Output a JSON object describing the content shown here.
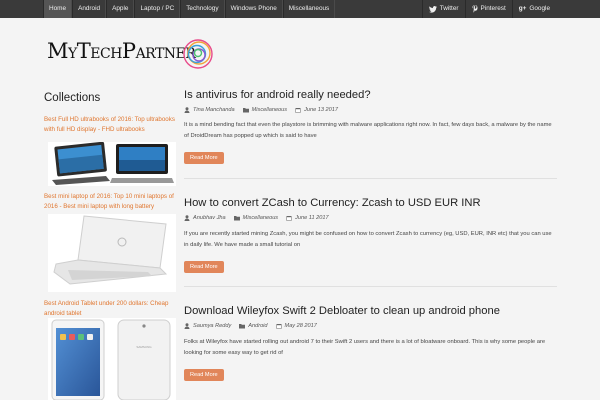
{
  "nav": {
    "items": [
      "Home",
      "Android",
      "Apple",
      "Laptop / PC",
      "Technology",
      "Windows Phone",
      "Miscellaneous"
    ],
    "active": "Home"
  },
  "social": [
    {
      "label": "Twitter",
      "icon": "twitter-icon"
    },
    {
      "label": "Pinterest",
      "icon": "pinterest-icon"
    },
    {
      "label": "Google",
      "icon": "google-plus-icon"
    }
  ],
  "logo": {
    "text": "MyTechPartner"
  },
  "sidebar": {
    "title": "Collections",
    "items": [
      {
        "title": "Best Full HD ultrabooks of 2016: Top ultrabooks with full HD display - FHD ultrabooks",
        "image": "two-ultrabooks"
      },
      {
        "title": "Best mini laptop of 2016: Top 10 mini laptops of 2016 - Best mini laptop with long battery",
        "image": "white-dell-laptop"
      },
      {
        "title": "Best Android Tablet under 200 dollars: Cheap android tablet",
        "image": "samsung-tablets"
      }
    ]
  },
  "posts": [
    {
      "title": "Is antivirus for android really needed?",
      "author": "Tina Manchanda",
      "category": "Miscellaneous",
      "date": "June 13 2017",
      "excerpt": "It is a mind bending fact that even the playstore is brimming with malware applications right now. In fact, few days back, a malware by the name of DroidDream has popped up which is said to have",
      "read_more": "Read More"
    },
    {
      "title": "How to convert ZCash to Currency: Zcash to USD EUR INR",
      "author": "Anubhav Jha",
      "category": "Miscellaneous",
      "date": "June 11 2017",
      "excerpt": "If you are recently started mining Zcash, you might be confused on how to convert Zcash to currency (eg, USD, EUR, INR etc) that you can use in daily life. We have made a small tutorial on",
      "read_more": "Read More"
    },
    {
      "title": "Download Wileyfox Swift 2 Debloater to clean up android phone",
      "author": "Saumya Reddy",
      "category": "Android",
      "date": "May 28 2017",
      "excerpt": "Folks at Wileyfox have started rolling out android 7 to their Swift 2 users and there is a lot of bloatware onboard. This is why some people are looking for some easy way to get rid of",
      "read_more": "Read More"
    }
  ],
  "colors": {
    "accent": "#e0762f",
    "button": "#e1865a",
    "topbar": "#3a3a3a"
  }
}
